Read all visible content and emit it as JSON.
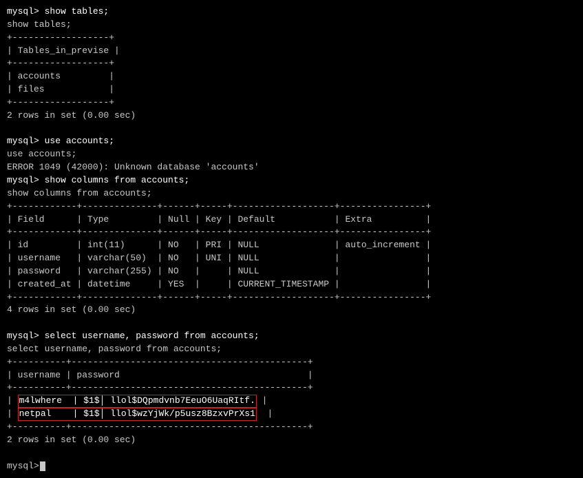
{
  "terminal": {
    "lines": [
      {
        "id": "l1",
        "text": "mysql> show tables;",
        "bright": true
      },
      {
        "id": "l2",
        "text": "show tables;",
        "bright": false
      },
      {
        "id": "l3",
        "text": "+------------------+",
        "bright": false
      },
      {
        "id": "l4",
        "text": "| Tables_in_previse |",
        "bright": false
      },
      {
        "id": "l5",
        "text": "+------------------+",
        "bright": false
      },
      {
        "id": "l6",
        "text": "| accounts         |",
        "bright": false
      },
      {
        "id": "l7",
        "text": "| files            |",
        "bright": false
      },
      {
        "id": "l8",
        "text": "+------------------+",
        "bright": false
      },
      {
        "id": "l9",
        "text": "2 rows in set (0.00 sec)",
        "bright": false
      },
      {
        "id": "l10",
        "text": "",
        "bright": false
      },
      {
        "id": "l11",
        "text": "mysql> use accounts;",
        "bright": true
      },
      {
        "id": "l12",
        "text": "use accounts;",
        "bright": false
      },
      {
        "id": "l13",
        "text": "ERROR 1049 (42000): Unknown database 'accounts'",
        "bright": false
      },
      {
        "id": "l14",
        "text": "mysql> show columns from accounts;",
        "bright": true
      },
      {
        "id": "l15",
        "text": "show columns from accounts;",
        "bright": false
      },
      {
        "id": "l16",
        "text": "+------------+--------------+------+-----+-------------------+----------------+",
        "bright": false
      },
      {
        "id": "l17",
        "text": "| Field      | Type         | Null | Key | Default           | Extra          |",
        "bright": false
      },
      {
        "id": "l18",
        "text": "+------------+--------------+------+-----+-------------------+----------------+",
        "bright": false
      },
      {
        "id": "l19a",
        "text": "| id         | int(11)      | NO   | PRI | NULL              | auto_increment |",
        "bright": false
      },
      {
        "id": "l19b",
        "text": "| username   | varchar(50)  | NO   | UNI | NULL              |                |",
        "bright": false
      },
      {
        "id": "l19c",
        "text": "| password   | varchar(255) | NO   |     | NULL              |                |",
        "bright": false
      },
      {
        "id": "l19d",
        "text": "| created_at | datetime     | YES  |     | CURRENT_TIMESTAMP |                |",
        "bright": false
      },
      {
        "id": "l20",
        "text": "+------------+--------------+------+-----+-------------------+----------------+",
        "bright": false
      },
      {
        "id": "l21",
        "text": "4 rows in set (0.00 sec)",
        "bright": false
      },
      {
        "id": "l22",
        "text": "",
        "bright": false
      },
      {
        "id": "l23",
        "text": "mysql> select username, password from accounts;",
        "bright": true
      },
      {
        "id": "l24",
        "text": "select username, password from accounts;",
        "bright": false
      },
      {
        "id": "l25",
        "text": "+----------+--------------------------------------------+",
        "bright": false
      },
      {
        "id": "l26",
        "text": "| username | password                                   |",
        "bright": false
      },
      {
        "id": "l27",
        "text": "+----------+--------------------------------------------+",
        "bright": false
      }
    ],
    "highlighted_rows": [
      {
        "id": "hr1",
        "pre": "| ",
        "highlighted": "m4lwhere  | $1$🔒| llol$DQpmdvnb7EeuO6UaqRItf.",
        "post": " |"
      },
      {
        "id": "hr2",
        "pre": "| ",
        "highlighted": "netpal    | $1$🔒| llol$wzYjWk/p5usz8BzxvPrXs1",
        "post": "  |"
      }
    ],
    "after_highlighted": [
      {
        "id": "al1",
        "text": "+----------+--------------------------------------------+",
        "bright": false
      },
      {
        "id": "al2",
        "text": "2 rows in set (0.00 sec)",
        "bright": false
      },
      {
        "id": "al3",
        "text": "",
        "bright": false
      }
    ],
    "prompt": "mysql> "
  }
}
